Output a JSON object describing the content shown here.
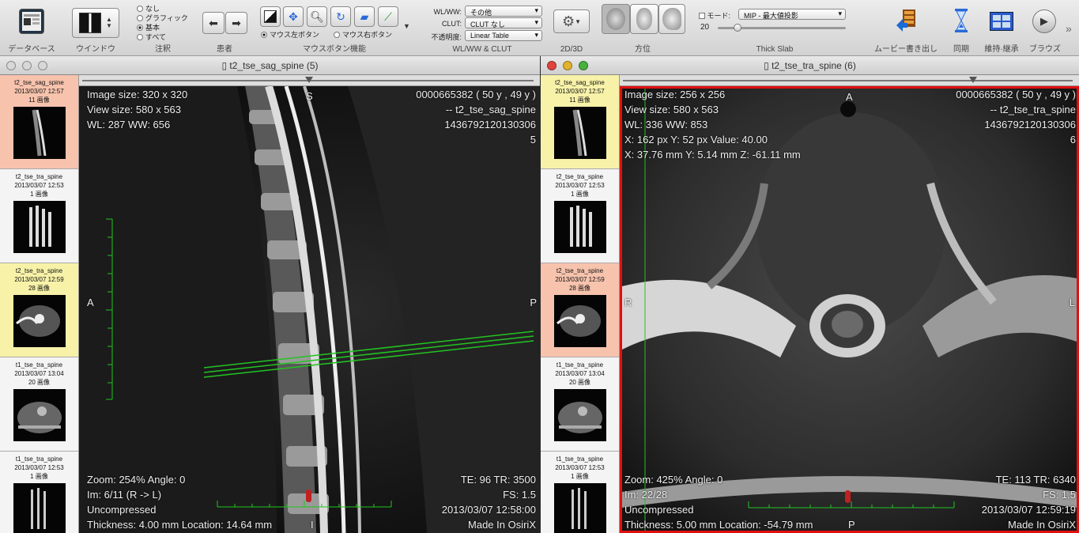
{
  "toolbar": {
    "database_label": "データベース",
    "window_label": "ウインドウ",
    "annotation_label": "注釈",
    "annotation_options": [
      "なし",
      "グラフィック",
      "基本",
      "すべて"
    ],
    "annotation_selected": 2,
    "patient_label": "患者",
    "mouse_label": "マウスボタン機能",
    "mouse_left": "マウス左ボタン",
    "mouse_right": "マウス右ボタン",
    "wlww_label": "WL/WW & CLUT",
    "wlww_field_label": "WL/WW:",
    "wlww_value": "その他",
    "clut_field_label": "CLUT:",
    "clut_value": "CLUT なし",
    "opacity_field_label": "不透明度:",
    "opacity_value": "Linear Table",
    "view2d3d_label": "2D/3D",
    "orientation_label": "方位",
    "thickslab_label": "Thick Slab",
    "mode_label": "モード:",
    "mode_value": "MIP - 最大値投影",
    "slab_value": "20",
    "movie_label": "ムービー書き出し",
    "sync_label": "同期",
    "keep_label": "維持·継承",
    "browse_label": "ブラウズ"
  },
  "window_left": {
    "title": "t2_tse_sag_spine (5)",
    "overlay": {
      "image_size": "Image size: 320 x 320",
      "view_size": "View size: 580 x 563",
      "wlww": "WL: 287 WW: 656",
      "patient_id": "0000665382 (  50 y ,  49 y )",
      "series": "-- t2_tse_sag_spine",
      "study_id": "1436792120130306",
      "series_no": "5",
      "top_marker": "S",
      "left_marker": "A",
      "right_marker": "P",
      "zoom": "Zoom: 254% Angle: 0",
      "im": "Im: 6/11  (R -> L)",
      "compression": "Uncompressed",
      "thickness": "Thickness: 4.00 mm Location: 14.64 mm",
      "bottom_marker": "I",
      "te_tr": "TE:  96 TR:  3500",
      "fs": "FS:  1.5",
      "date": "2013/03/07 12:58:00",
      "made_in": "Made In OsiriX"
    }
  },
  "window_right": {
    "title": "t2_tse_tra_spine (6)",
    "overlay": {
      "image_size": "Image size: 256 x 256",
      "view_size": "View size: 580 x 563",
      "wlww": "WL: 336 WW: 853",
      "pixel": "X: 162 px Y: 52 px Value: 40.00",
      "mm": "X: 37.76 mm Y: 5.14 mm Z: -61.11 mm",
      "patient_id": "0000665382 (  50 y ,  49 y )",
      "series": "-- t2_tse_tra_spine",
      "study_id": "1436792120130306",
      "series_no": "6",
      "top_marker": "A",
      "left_marker": "R",
      "right_marker": "L",
      "zoom": "Zoom: 425% Angle: 0",
      "im": "Im: 22/28",
      "compression": "Uncompressed",
      "thickness": "Thickness: 5.00 mm Location: -54.79 mm",
      "bottom_marker": "P",
      "te_tr": "TE:  113 TR:  6340",
      "fs": "FS:  1.5",
      "date": "2013/03/07 12:59:19",
      "made_in": "Made In OsiriX"
    }
  },
  "series_list": [
    {
      "name": "t2_tse_sag_spine",
      "date": "2013/03/07 12:57",
      "count": "11 画像"
    },
    {
      "name": "t2_tse_tra_spine",
      "date": "2013/03/07 12:53",
      "count": "1 画像"
    },
    {
      "name": "t2_tse_tra_spine",
      "date": "2013/03/07 12:59",
      "count": "28 画像"
    },
    {
      "name": "t1_tse_tra_spine",
      "date": "2013/03/07 13:04",
      "count": "20 画像"
    },
    {
      "name": "t1_tse_tra_spine",
      "date": "2013/03/07 12:53",
      "count": "1 画像"
    }
  ],
  "colors": {
    "active_border": "#e01010",
    "scout_line": "#22c422",
    "sel_red": "#f7c3ad",
    "sel_yellow": "#f7f2a8"
  }
}
